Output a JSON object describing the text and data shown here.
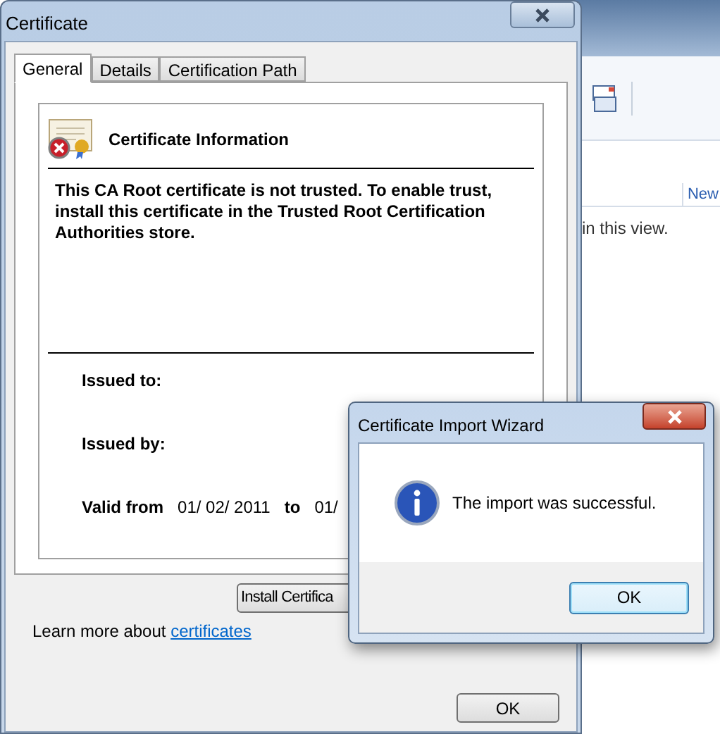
{
  "background_window": {
    "column_header": "New",
    "message": "in this view."
  },
  "certificate_window": {
    "title": "Certificate",
    "tabs": [
      {
        "label": "General",
        "selected": true
      },
      {
        "label": "Details",
        "selected": false
      },
      {
        "label": "Certification Path",
        "selected": false
      }
    ],
    "heading": "Certificate Information",
    "warning": "This CA Root certificate is not trusted. To enable trust, install this certificate in the Trusted Root Certification Authorities store.",
    "fields": [
      {
        "label": "Issued to:"
      },
      {
        "label": "Issued by:"
      }
    ],
    "validity": {
      "label": "Valid from",
      "from": "01/ 02/ 2011",
      "to_label": "to",
      "to": "01/"
    },
    "install_button": "Install Certifica",
    "learn_more": {
      "text": "Learn more about",
      "link": "certificates"
    },
    "ok_button": "OK"
  },
  "wizard": {
    "title": "Certificate Import Wizard",
    "message": "The import was successful.",
    "ok_button": "OK"
  }
}
